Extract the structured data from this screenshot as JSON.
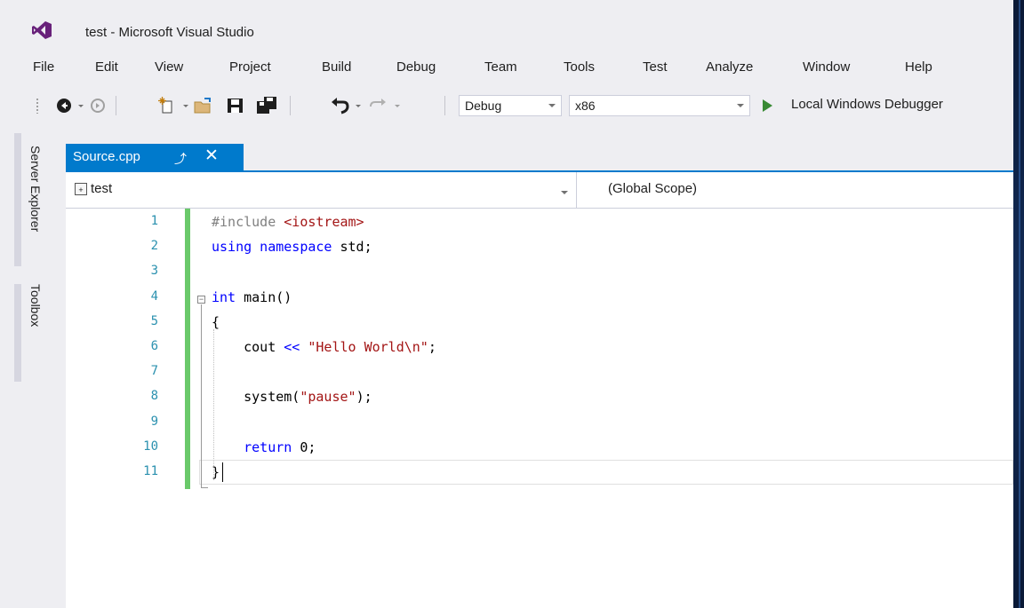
{
  "window": {
    "title": "test - Microsoft Visual Studio"
  },
  "menu": [
    "File",
    "Edit",
    "View",
    "Project",
    "Build",
    "Debug",
    "Team",
    "Tools",
    "Test",
    "Analyze",
    "Window",
    "Help"
  ],
  "toolbar": {
    "config": "Debug",
    "platform": "x86",
    "start_label": "Local Windows Debugger",
    "icons": [
      "back-icon",
      "forward-icon",
      "new-project-icon",
      "open-file-icon",
      "save-icon",
      "save-all-icon",
      "undo-icon",
      "redo-icon"
    ]
  },
  "sidebar": {
    "tabs": [
      "Server Explorer",
      "Toolbox"
    ]
  },
  "document": {
    "tab_label": "Source.cpp",
    "nav_project": "test",
    "nav_scope": "(Global Scope)"
  },
  "code": {
    "line_numbers": [
      "1",
      "2",
      "3",
      "4",
      "5",
      "6",
      "7",
      "8",
      "9",
      "10",
      "11"
    ],
    "lines": [
      [
        {
          "t": "#include ",
          "c": "pp"
        },
        {
          "t": "<iostream>",
          "c": "str"
        }
      ],
      [
        {
          "t": "using namespace",
          "c": "kw"
        },
        {
          "t": " std;",
          "c": ""
        }
      ],
      [],
      [
        {
          "t": "int",
          "c": "kw"
        },
        {
          "t": " main()",
          "c": ""
        }
      ],
      [
        {
          "t": "{",
          "c": ""
        }
      ],
      [
        {
          "t": "    cout ",
          "c": ""
        },
        {
          "t": "<<",
          "c": "kw"
        },
        {
          "t": " ",
          "c": ""
        },
        {
          "t": "\"Hello World\\n\"",
          "c": "str"
        },
        {
          "t": ";",
          "c": ""
        }
      ],
      [],
      [
        {
          "t": "    system(",
          "c": ""
        },
        {
          "t": "\"pause\"",
          "c": "str"
        },
        {
          "t": ");",
          "c": ""
        }
      ],
      [],
      [
        {
          "t": "    ",
          "c": ""
        },
        {
          "t": "return",
          "c": "kw"
        },
        {
          "t": " 0;",
          "c": ""
        }
      ],
      [
        {
          "t": "}",
          "c": ""
        }
      ]
    ]
  },
  "colors": {
    "accent": "#007acc",
    "line_number": "#2b91af",
    "keyword": "#0000ff",
    "string": "#a31515",
    "preprocessor": "#808080",
    "change_bar": "#6ac96a",
    "start_green": "#388a34"
  }
}
